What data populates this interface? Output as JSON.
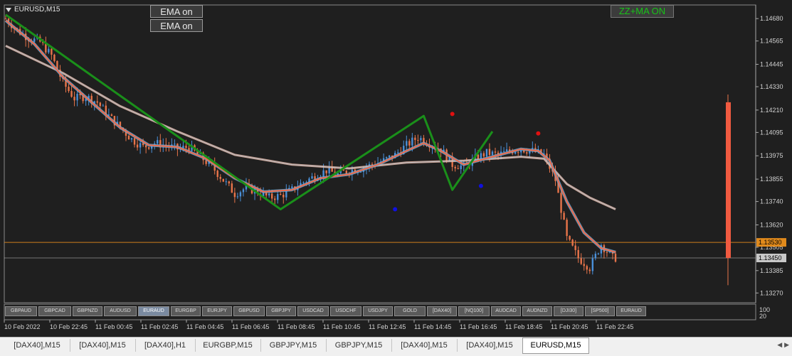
{
  "window": {
    "symbol_title": "EURUSD,M15"
  },
  "buttons": {
    "ema1": "EMA on",
    "ema2": "EMA on",
    "zigzag": "ZZ+MA ON"
  },
  "colors": {
    "background": "#1f1f1f",
    "grid": "#4a4a4a",
    "bull": "#4a90d9",
    "bear": "#e8744a",
    "zigzag": "#1a8f1a",
    "ema_fast": "#f06a4a",
    "ema_fast_blue": "#6ab0e0",
    "ema_slow": "#e8b8a8",
    "hline": "#e08a1c",
    "dot_red": "#e01010",
    "dot_blue": "#1010e0"
  },
  "chart_data": {
    "type": "candlestick",
    "y_ticks": [
      "1.14680",
      "1.14565",
      "1.14445",
      "1.14330",
      "1.14210",
      "1.14095",
      "1.13975",
      "1.13855",
      "1.13740",
      "1.13620",
      "1.13505",
      "1.13385",
      "1.13270"
    ],
    "ylim": [
      1.1322,
      1.1475
    ],
    "price_tags": [
      {
        "label": "1.13530",
        "value": 1.1353,
        "color": "#e08a1c"
      },
      {
        "label": "1.13450",
        "value": 1.1345,
        "color": "#c8c8c8"
      }
    ],
    "x_labels": [
      "10 Feb 2022",
      "10 Feb 22:45",
      "11 Feb 00:45",
      "11 Feb 02:45",
      "11 Feb 04:45",
      "11 Feb 06:45",
      "11 Feb 08:45",
      "11 Feb 10:45",
      "11 Feb 12:45",
      "11 Feb 14:45",
      "11 Feb 16:45",
      "11 Feb 18:45",
      "11 Feb 20:45",
      "11 Feb 22:45"
    ],
    "close_points": [
      [
        0,
        1.1468
      ],
      [
        4,
        1.1462
      ],
      [
        8,
        1.1458
      ],
      [
        12,
        1.1456
      ],
      [
        16,
        1.1449
      ],
      [
        20,
        1.1435
      ],
      [
        24,
        1.1427
      ],
      [
        28,
        1.1428
      ],
      [
        32,
        1.1425
      ],
      [
        36,
        1.1418
      ],
      [
        40,
        1.1412
      ],
      [
        44,
        1.1406
      ],
      [
        48,
        1.1402
      ],
      [
        52,
        1.1404
      ],
      [
        56,
        1.1403
      ],
      [
        60,
        1.1401
      ],
      [
        64,
        1.1402
      ],
      [
        68,
        1.1397
      ],
      [
        72,
        1.1392
      ],
      [
        76,
        1.1385
      ],
      [
        80,
        1.1378
      ],
      [
        84,
        1.1381
      ],
      [
        88,
        1.1379
      ],
      [
        92,
        1.1376
      ],
      [
        96,
        1.1377
      ],
      [
        100,
        1.138
      ],
      [
        104,
        1.1384
      ],
      [
        108,
        1.1387
      ],
      [
        112,
        1.139
      ],
      [
        116,
        1.1388
      ],
      [
        120,
        1.139
      ],
      [
        124,
        1.1391
      ],
      [
        128,
        1.1393
      ],
      [
        132,
        1.1395
      ],
      [
        136,
        1.1398
      ],
      [
        140,
        1.1403
      ],
      [
        144,
        1.1407
      ],
      [
        148,
        1.1404
      ],
      [
        152,
        1.1401
      ],
      [
        156,
        1.1393
      ],
      [
        160,
        1.1392
      ],
      [
        164,
        1.1396
      ],
      [
        168,
        1.1399
      ],
      [
        172,
        1.1398
      ],
      [
        176,
        1.14
      ],
      [
        180,
        1.1401
      ],
      [
        184,
        1.14
      ],
      [
        188,
        1.1398
      ],
      [
        192,
        1.1385
      ],
      [
        196,
        1.1355
      ],
      [
        200,
        1.1345
      ],
      [
        204,
        1.134
      ],
      [
        208,
        1.1352
      ],
      [
        212,
        1.1345
      ]
    ],
    "zigzag": [
      [
        0,
        1.147
      ],
      [
        96,
        1.137
      ],
      [
        146,
        1.1418
      ],
      [
        156,
        1.138
      ],
      [
        170,
        1.141
      ]
    ],
    "ema_fast": [
      [
        0,
        1.1467
      ],
      [
        10,
        1.1455
      ],
      [
        20,
        1.1438
      ],
      [
        30,
        1.1425
      ],
      [
        40,
        1.1412
      ],
      [
        50,
        1.1403
      ],
      [
        60,
        1.1402
      ],
      [
        70,
        1.1396
      ],
      [
        80,
        1.1386
      ],
      [
        90,
        1.1379
      ],
      [
        100,
        1.138
      ],
      [
        110,
        1.1386
      ],
      [
        120,
        1.1388
      ],
      [
        130,
        1.1393
      ],
      [
        140,
        1.14
      ],
      [
        146,
        1.1404
      ],
      [
        152,
        1.14
      ],
      [
        160,
        1.1393
      ],
      [
        170,
        1.1397
      ],
      [
        180,
        1.1401
      ],
      [
        186,
        1.14
      ],
      [
        190,
        1.1395
      ],
      [
        196,
        1.1374
      ],
      [
        202,
        1.1358
      ],
      [
        208,
        1.135
      ],
      [
        213,
        1.1348
      ]
    ],
    "ema_slow": [
      [
        0,
        1.1454
      ],
      [
        20,
        1.144
      ],
      [
        40,
        1.1423
      ],
      [
        60,
        1.141
      ],
      [
        80,
        1.1398
      ],
      [
        100,
        1.1393
      ],
      [
        120,
        1.1391
      ],
      [
        140,
        1.1394
      ],
      [
        160,
        1.1395
      ],
      [
        180,
        1.1397
      ],
      [
        188,
        1.1396
      ],
      [
        196,
        1.1383
      ],
      [
        204,
        1.1376
      ],
      [
        213,
        1.137
      ]
    ],
    "dots": [
      {
        "x": 156,
        "y": 1.1419,
        "color": "red"
      },
      {
        "x": 186,
        "y": 1.1409,
        "color": "red"
      },
      {
        "x": 136,
        "y": 1.137,
        "color": "blue"
      },
      {
        "x": 166,
        "y": 1.1382,
        "color": "blue"
      }
    ]
  },
  "symbol_buttons": [
    "GBPAUD",
    "GBPCAD",
    "GBPNZD",
    "AUDUSD",
    "EURAUD",
    "EURGBP",
    "EURJPY",
    "GBPUSD",
    "GBPJPY",
    "USDCAD",
    "USDCHF",
    "USDJPY",
    "GOLD",
    "[DAX40]",
    "[NQ100]",
    "AUDCAD",
    "AUDNZD",
    "[DJI30]",
    "[SP500]",
    "EURAUD"
  ],
  "symbol_buttons_active": 4,
  "subwindow": {
    "label_top": "100",
    "label_bottom": "20"
  },
  "tabs": [
    "[DAX40],M15",
    "[DAX40],M15",
    "[DAX40],H1",
    "EURGBP,M15",
    "GBPJPY,M15",
    "GBPJPY,M15",
    "[DAX40],M15",
    "[DAX40],M15",
    "EURUSD,M15"
  ],
  "active_tab": 8
}
